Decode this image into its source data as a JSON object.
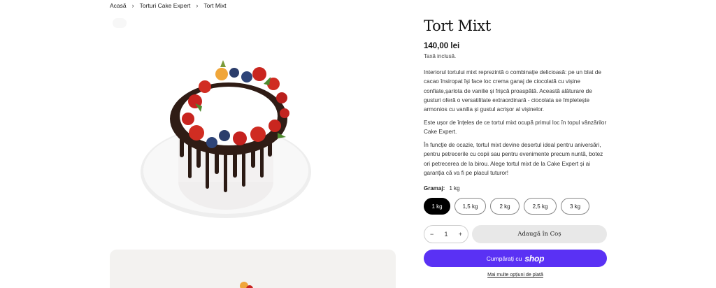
{
  "breadcrumb": {
    "home": "Acasă",
    "category": "Torturi Cake Expert",
    "current": "Tort Mixt"
  },
  "product": {
    "title": "Tort Mixt",
    "price": "140,00 lei",
    "tax_note": "Taxă inclusă.",
    "description": [
      "Interiorul tortului mixt reprezintă o combinație delicioasă: pe un blat de cacao însiropat își face loc crema ganaj de ciocolată cu vișine confiate,șarlota de vanilie și frișcă proaspătă. Această alăturare de gusturi oferă o versatilitate extraordinară - ciocolata se împletește armonios cu vanilia și gustul acrișor al vișinelor.",
      "Este ușor de înțeles de ce tortul mixt ocupă primul loc în topul vânzărilor Cake Expert.",
      "În funcție de ocazie, tortul mixt devine desertul ideal pentru aniversări, pentru petrecerile cu copii sau pentru evenimente precum nuntă, botez ori petrecerea de la birou. Alege tortul mixt de la Cake Expert și ai garanția că va fi pe placul tuturor!"
    ]
  },
  "variant": {
    "label": "Gramaj:",
    "selected": "1 kg",
    "options": [
      "1 kg",
      "1,5 kg",
      "2 kg",
      "2,5 kg",
      "3 kg"
    ]
  },
  "quantity": {
    "minus": "−",
    "value": "1",
    "plus": "+"
  },
  "buttons": {
    "add_to_cart": "Adaugă în Coș",
    "buy_with": "Cumpărați cu",
    "shop_brand": "shop",
    "more_payment": "Mai multe opțiuni de plată"
  },
  "colors": {
    "shop_pay": "#5a31f4",
    "selected_pill": "#000000",
    "add_cart_bg": "#e8e8e8"
  }
}
